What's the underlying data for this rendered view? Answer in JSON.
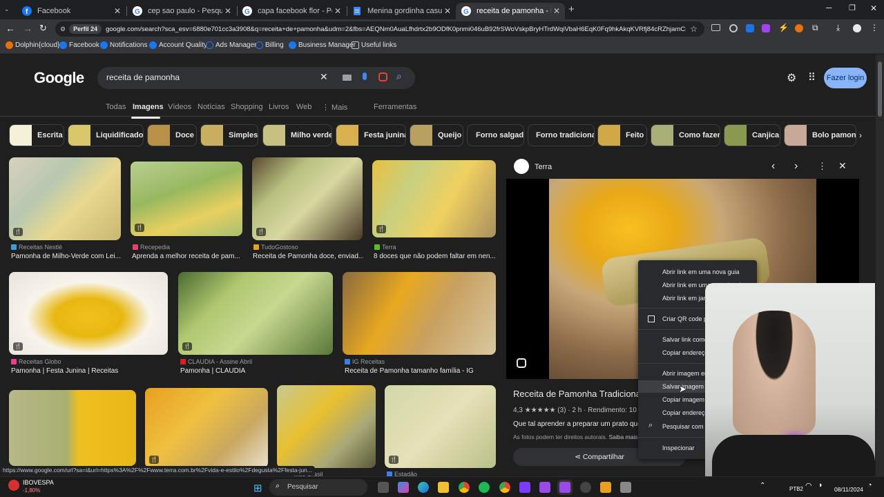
{
  "tabs": [
    {
      "title": "Facebook",
      "icon": "facebook-icon"
    },
    {
      "title": "cep sao paulo - Pesquisa Goog",
      "icon": "google-icon"
    },
    {
      "title": "capa facebook flor - Pesquisa G",
      "icon": "google-icon"
    },
    {
      "title": "Menina gordinha casual em je",
      "icon": "docs-icon"
    },
    {
      "title": "receita de pamonha - Pesquisa",
      "icon": "google-icon"
    }
  ],
  "profile": "Perfil 24",
  "url": "google.com/search?sca_esv=6880e701cc3a3908&q=receita+de+pamonha&udm=2&fbs=AEQNm0AuaLfhdrtx2b9ODfK0pnmi046uB92frSWoVskpBryHTrdWqiVbaH6EqK0Fq9hkAkqKVRfj84cRZhjamCpjPYz8E...",
  "bookmarks": [
    "Dolphin{cloud}",
    "Facebook",
    "Notifications",
    "Account Quality",
    "Ads Manager",
    "Billing",
    "Business Manager",
    "Useful links"
  ],
  "search": {
    "logo": "Google",
    "query": "receita de pamonha",
    "login": "Fazer login"
  },
  "nav": [
    "Todas",
    "Imagens",
    "Vídeos",
    "Notícias",
    "Shopping",
    "Livros",
    "Web",
    "⋮ Mais",
    "Ferramentas"
  ],
  "chips": [
    "Escrita",
    "Liquidificador",
    "Doce",
    "Simples",
    "Milho verde",
    "Festa junina",
    "Queijo",
    "Forno salgada",
    "Forno tradicional",
    "Feito",
    "Como fazer",
    "Canjica",
    "Bolo pamonha"
  ],
  "results": [
    {
      "source": "Receitas Nestlé",
      "caption": "Pamonha de Milho-Verde com Lei..."
    },
    {
      "source": "Recepedia",
      "caption": "Aprenda a melhor receita de pam..."
    },
    {
      "source": "TudoGostoso",
      "caption": "Receita de Pamonha doce, enviad..."
    },
    {
      "source": "Terra",
      "caption": "8 doces que não podem faltar em nen..."
    },
    {
      "source": "Receitas Globo",
      "caption": "Pamonha | Festa Junina | Receitas"
    },
    {
      "source": "CLAUDIA - Assine Abril",
      "caption": "Pamonha | CLAUDIA"
    },
    {
      "source": "IG Receitas",
      "caption": "Receita de Pamonha tamanho família - IG"
    },
    {
      "source": "",
      "caption": ""
    },
    {
      "source": "",
      "caption": ""
    },
    {
      "source": "...ao Brasil",
      "caption": ""
    },
    {
      "source": "Estadão",
      "caption": ""
    }
  ],
  "panel": {
    "source": "Terra",
    "title": "Receita de Pamonha Tradicional",
    "rating": "4,3",
    "stars": "★★★★★",
    "reviews": "(3)",
    "time": "2 h",
    "yield": "Rendimento: 10",
    "desc": "Que tal aprender a preparar um prato que fa",
    "copyright": "As fotos podem ter direitos autorais.",
    "more": "Saiba mais",
    "share": "Compartilhar"
  },
  "context_menu": [
    "Abrir link em uma nova guia",
    "Abrir link em uma nova janela",
    "Abrir link em janela anônima",
    "Criar QR code para esta imagem",
    "Salvar link como...",
    "Copiar endereço do link",
    "Abrir imagem em nova guia",
    "Salvar imagem como...",
    "Copiar imagem",
    "Copiar endereço da imagem",
    "Pesquisar com o Google",
    "Inspecionar"
  ],
  "status_url": "https://www.google.com/url?sa=i&url=https%3A%2F%2Fwww.terra.com.br%2Fvida-e-estilo%2Fdegusta%2Ffesta-jun...",
  "taskbar": {
    "ticker": "IBOVESPA",
    "change": "-1,80%",
    "search": "Pesquisar",
    "lang": "PTB2",
    "date": "08/11/2024"
  }
}
